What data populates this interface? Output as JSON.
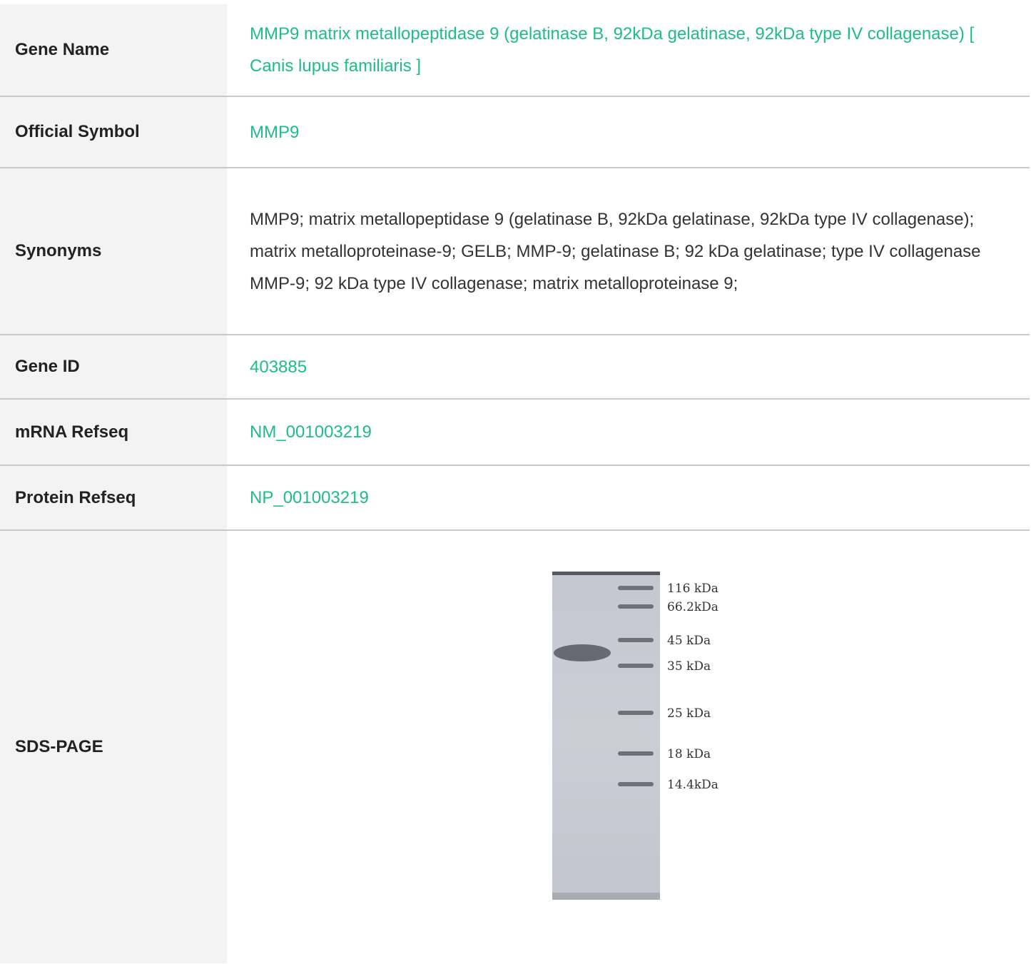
{
  "rows": [
    {
      "label": "Gene Name",
      "value": "MMP9 matrix metallopeptidase 9 (gelatinase B, 92kDa gelatinase, 92kDa type IV collagenase) [ Canis lupus familiaris ]"
    },
    {
      "label": "Official Symbol",
      "value": "MMP9"
    },
    {
      "label": "Synonyms",
      "value": "MMP9; matrix metallopeptidase 9 (gelatinase B, 92kDa gelatinase, 92kDa type IV collagenase); matrix metalloproteinase-9; GELB; MMP-9; gelatinase B; 92 kDa gelatinase; type IV collagenase MMP-9; 92 kDa type IV collagenase; matrix metalloproteinase 9;"
    },
    {
      "label": "Gene ID",
      "value": "403885"
    },
    {
      "label": "mRNA Refseq",
      "value": "NM_001003219"
    },
    {
      "label": "Protein Refseq",
      "value": "NP_001003219"
    },
    {
      "label": "SDS-PAGE"
    }
  ],
  "gel": {
    "markers": [
      "116 kDa",
      "66.2kDa",
      "45 kDa",
      "35 kDa",
      "25 kDa",
      "18 kDa",
      "14.4kDa"
    ]
  },
  "colors": {
    "link": "#1fbc8b",
    "label_bg": "#f3f3f3",
    "divider": "#c9c9c9"
  }
}
